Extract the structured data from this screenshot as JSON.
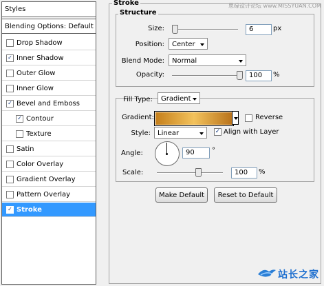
{
  "left_panel": {
    "header": "Styles",
    "blending": "Blending Options: Default",
    "items": [
      {
        "label": "Drop Shadow",
        "checked": false
      },
      {
        "label": "Inner Shadow",
        "checked": true
      },
      {
        "label": "Outer Glow",
        "checked": false
      },
      {
        "label": "Inner Glow",
        "checked": false
      },
      {
        "label": "Bevel and Emboss",
        "checked": true
      },
      {
        "label": "Contour",
        "checked": true
      },
      {
        "label": "Texture",
        "checked": false
      },
      {
        "label": "Satin",
        "checked": false
      },
      {
        "label": "Color Overlay",
        "checked": false
      },
      {
        "label": "Gradient Overlay",
        "checked": false
      },
      {
        "label": "Pattern Overlay",
        "checked": false
      },
      {
        "label": "Stroke",
        "checked": true
      }
    ]
  },
  "stroke": {
    "title": "Stroke",
    "structure_title": "Structure",
    "size_label": "Size:",
    "size_value": "6",
    "size_unit": "px",
    "position_label": "Position:",
    "position_value": "Center",
    "blend_mode_label": "Blend Mode:",
    "blend_mode_value": "Normal",
    "opacity_label": "Opacity:",
    "opacity_value": "100",
    "opacity_unit": "%",
    "fill_type_label": "Fill Type:",
    "fill_type_value": "Gradient",
    "gradient_label": "Gradient:",
    "reverse_label": "Reverse",
    "style_label": "Style:",
    "style_value": "Linear",
    "align_label": "Align with Layer",
    "angle_label": "Angle:",
    "angle_value": "90",
    "angle_unit": "°",
    "scale_label": "Scale:",
    "scale_value": "100",
    "scale_unit": "%"
  },
  "buttons": {
    "make_default": "Make Default",
    "reset_default": "Reset to Default"
  },
  "watermark": {
    "top": "思缘设计论坛 www.MISSYUAN.COM",
    "bottom": "站长之家"
  },
  "colors": {
    "selection": "#3399ff",
    "gradient_start": "#c57f1b",
    "gradient_mid": "#f3c25c",
    "gradient_end": "#b8721a"
  }
}
